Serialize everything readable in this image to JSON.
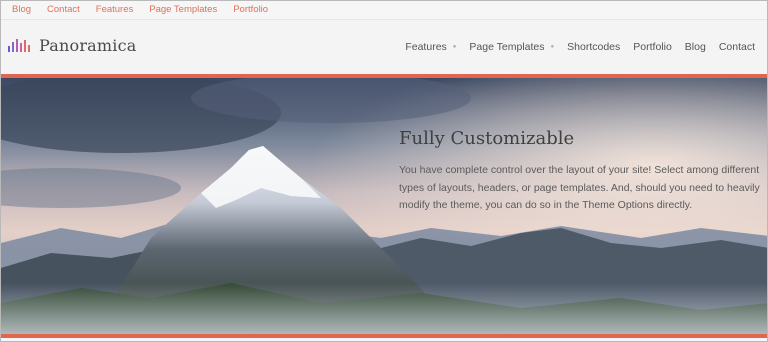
{
  "topbar": {
    "links": [
      "Blog",
      "Contact",
      "Features",
      "Page Templates",
      "Portfolio"
    ]
  },
  "header": {
    "logo_text": "Panoramica",
    "nav": [
      {
        "label": "Features",
        "has_dropdown": true
      },
      {
        "label": "Page Templates",
        "has_dropdown": true
      },
      {
        "label": "Shortcodes",
        "has_dropdown": false
      },
      {
        "label": "Portfolio",
        "has_dropdown": false
      },
      {
        "label": "Blog",
        "has_dropdown": false
      },
      {
        "label": "Contact",
        "has_dropdown": false
      }
    ]
  },
  "hero": {
    "title": "Fully Customizable",
    "text": "You have complete control over the layout of your site! Select among different types of layouts, headers, or page templates. And, should you need to heavily modify the theme, you can do so in the Theme Options directly."
  },
  "colors": {
    "accent": "#e2664f",
    "topbar_link": "#e0705c"
  }
}
